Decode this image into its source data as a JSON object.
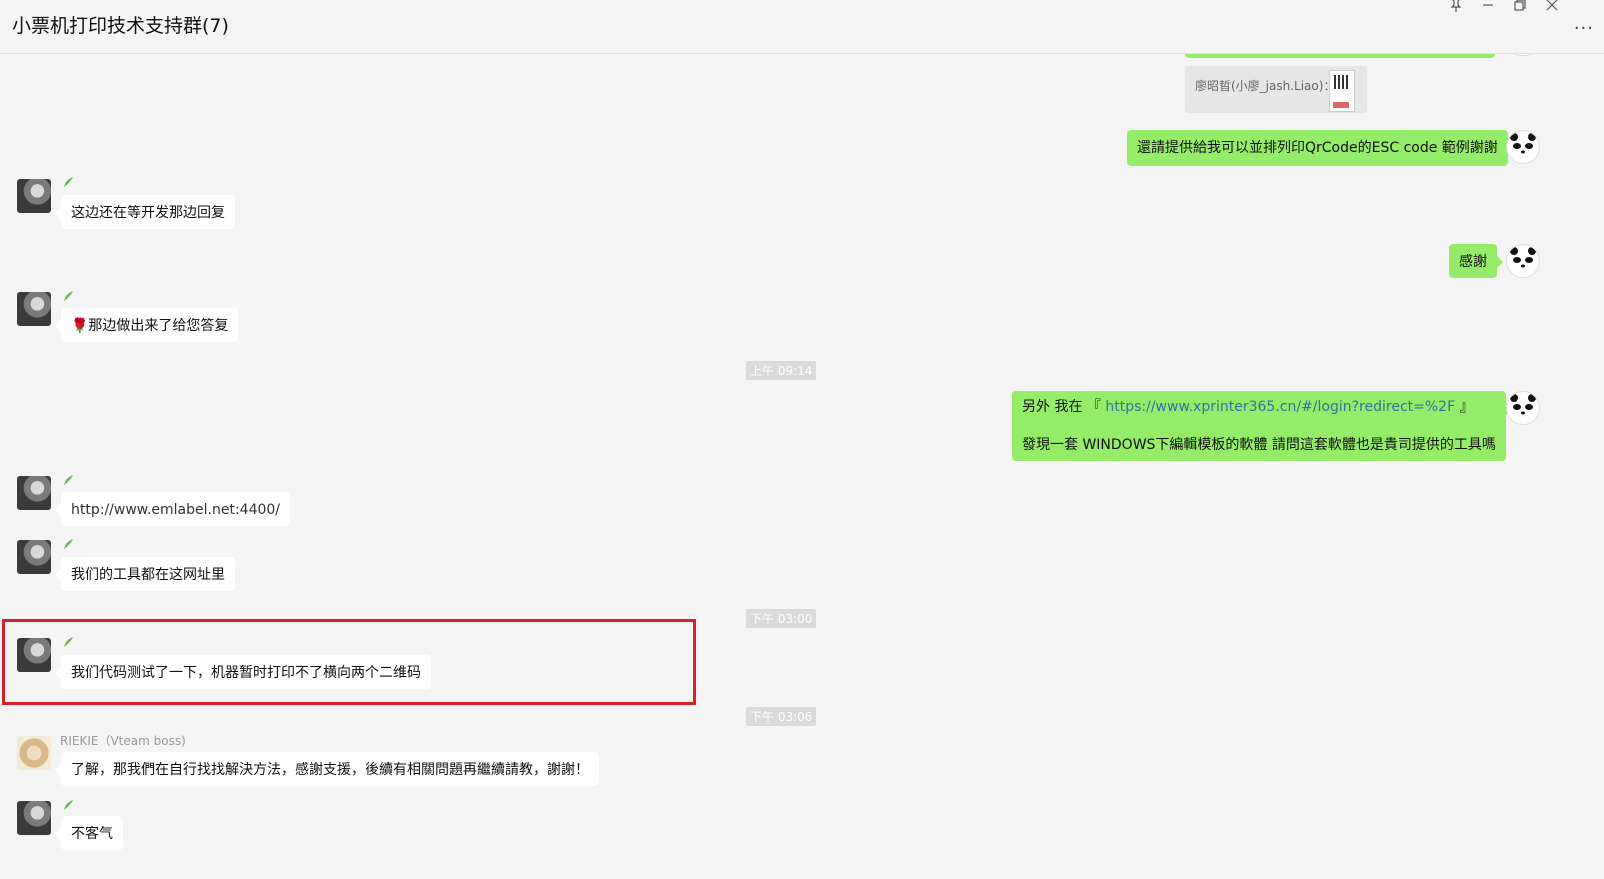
{
  "window": {
    "title": "小票机打印技术支持群(7)",
    "pin_icon": "pin-icon",
    "minimize_icon": "minimize-icon",
    "restore_icon": "restore-icon",
    "close_icon": "close-icon",
    "more_label": "···"
  },
  "messages": {
    "quote_text": "廖昭晢(小廖_jash.Liao)：",
    "m1_text": "還請提供給我可以並排列印QrCode的ESC code 範例謝謝",
    "m2_text": "这边还在等开发那边回复",
    "m3_text": "感謝",
    "m4_text": "🌹那边做出来了给您答复",
    "time1": "上午 09:14",
    "m5_prefix": "另外 我在 『 ",
    "m5_link": "https://www.xprinter365.cn/#/login?redirect=%2F",
    "m5_suffix": " 』",
    "m5_line2": "發現一套 WINDOWS下編輯模板的軟體 請問這套軟體也是貴司提供的工具嗎",
    "m6_text": "http://www.emlabel.net:4400/",
    "m7_text": "我们的工具都在这网址里",
    "time2": "下午 03:00",
    "m8_text": "我们代码测试了一下，机器暂时打印不了横向两个二维码",
    "time3": "下午 03:06",
    "riekie_name": "RIEKIE（Vteam boss)",
    "m9_text": "了解，那我們在自行找找解決方法，感謝支援，後續有相關問題再繼續請教，謝謝！",
    "m10_text": "不客气"
  },
  "colors": {
    "mine_bubble": "#95ec69",
    "other_bubble": "#ffffff",
    "highlight": "#d9202a",
    "link": "#3a6ea5"
  }
}
